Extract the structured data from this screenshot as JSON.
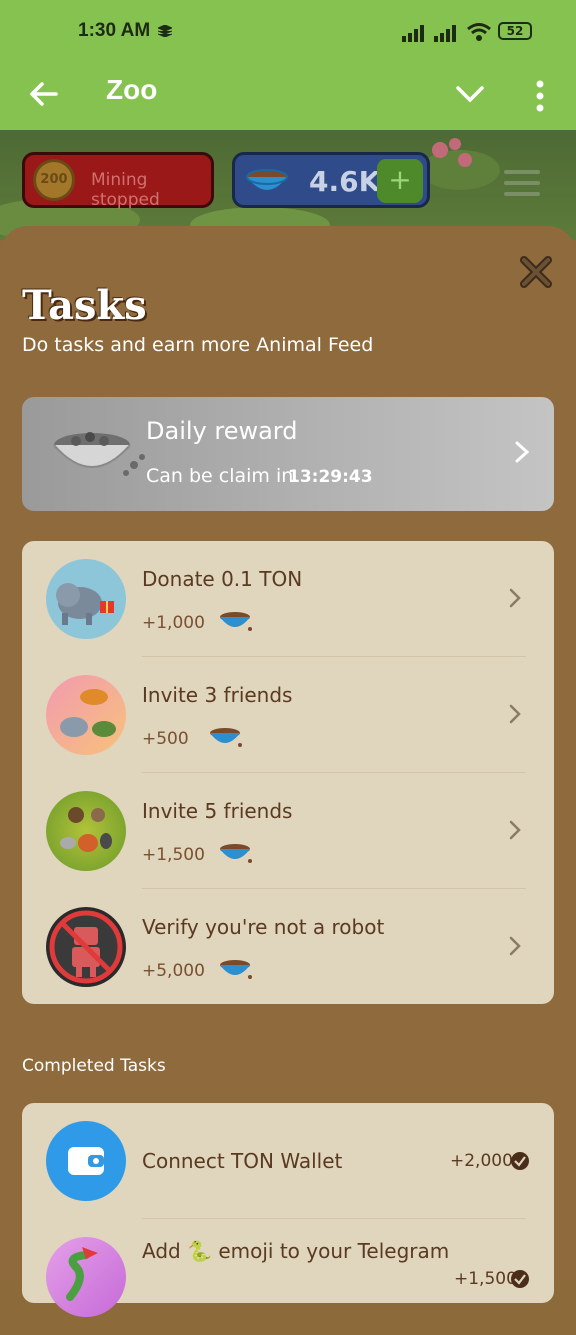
{
  "status": {
    "time": "1:30 AM",
    "battery": "52"
  },
  "appbar": {
    "title": "Zoo"
  },
  "game": {
    "coin_label": "200",
    "mining_status": "Mining stopped",
    "feed_total": "4.6K",
    "plus": "+"
  },
  "sheet": {
    "title": "Tasks",
    "subtitle": "Do tasks and earn more Animal Feed",
    "daily": {
      "title": "Daily reward",
      "claim_label": "Can be claim in",
      "timer": "13:29:43"
    },
    "tasks": [
      {
        "label": "Donate 0.1 TON",
        "reward": "+1,000",
        "icon": "elephant-gift-icon"
      },
      {
        "label": "Invite 3 friends",
        "reward": "+500",
        "icon": "animals-group-icon"
      },
      {
        "label": "Invite 5 friends",
        "reward": "+1,500",
        "icon": "animals-group-large-icon"
      },
      {
        "label": "Verify you're not a robot",
        "reward": "+5,000",
        "icon": "no-robot-icon"
      }
    ],
    "completed_title": "Completed Tasks",
    "completed": [
      {
        "label": "Connect TON Wallet",
        "reward": "+2,000",
        "icon": "wallet-icon"
      },
      {
        "label": "Add 🐍 emoji to your Telegram",
        "reward": "+1,500",
        "icon": "snake-icon"
      }
    ]
  },
  "colors": {
    "appbar": "#86c24f",
    "sheet": "#8e6a3c",
    "card": "#e0d5bd",
    "text_brown": "#5a3a20"
  }
}
